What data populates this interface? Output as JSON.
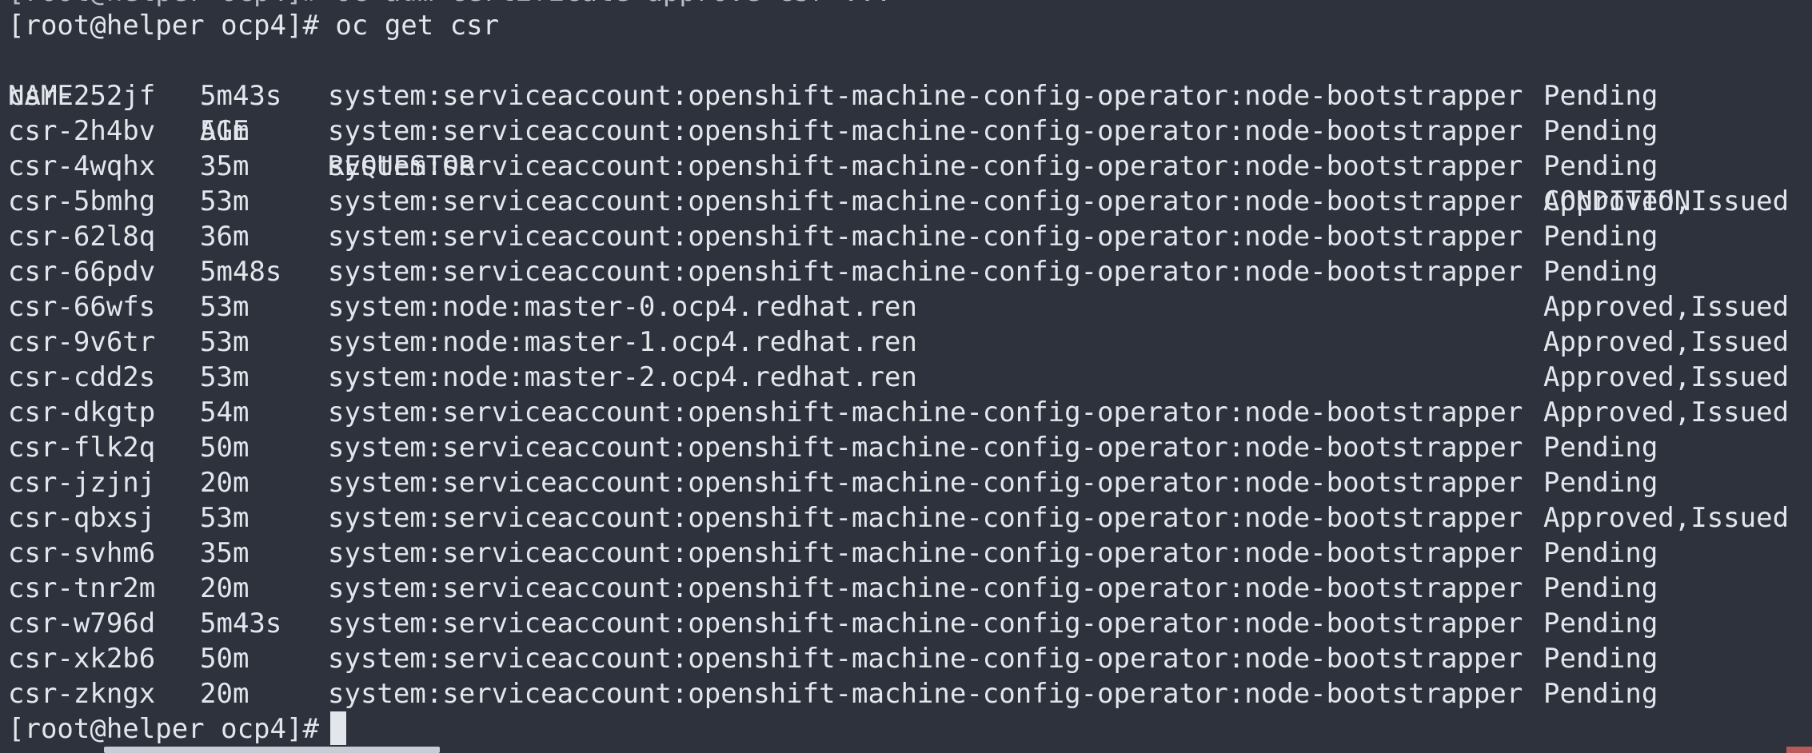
{
  "clipped_line": "[root@helper ocp4]# oc adm certificate approve csr-...",
  "command_line": {
    "prompt": "[root@helper ocp4]#",
    "command": "oc get csr"
  },
  "table": {
    "headers": {
      "name": "NAME",
      "age": "AGE",
      "requestor": "REQUESTOR",
      "condition": "CONDITION"
    },
    "rows": [
      {
        "name": "csr-252jf",
        "age": "5m43s",
        "requestor": "system:serviceaccount:openshift-machine-config-operator:node-bootstrapper",
        "condition": "Pending"
      },
      {
        "name": "csr-2h4bv",
        "age": "51m",
        "requestor": "system:serviceaccount:openshift-machine-config-operator:node-bootstrapper",
        "condition": "Pending"
      },
      {
        "name": "csr-4wqhx",
        "age": "35m",
        "requestor": "system:serviceaccount:openshift-machine-config-operator:node-bootstrapper",
        "condition": "Pending"
      },
      {
        "name": "csr-5bmhg",
        "age": "53m",
        "requestor": "system:serviceaccount:openshift-machine-config-operator:node-bootstrapper",
        "condition": "Approved,Issued"
      },
      {
        "name": "csr-62l8q",
        "age": "36m",
        "requestor": "system:serviceaccount:openshift-machine-config-operator:node-bootstrapper",
        "condition": "Pending"
      },
      {
        "name": "csr-66pdv",
        "age": "5m48s",
        "requestor": "system:serviceaccount:openshift-machine-config-operator:node-bootstrapper",
        "condition": "Pending"
      },
      {
        "name": "csr-66wfs",
        "age": "53m",
        "requestor": "system:node:master-0.ocp4.redhat.ren",
        "condition": "Approved,Issued"
      },
      {
        "name": "csr-9v6tr",
        "age": "53m",
        "requestor": "system:node:master-1.ocp4.redhat.ren",
        "condition": "Approved,Issued"
      },
      {
        "name": "csr-cdd2s",
        "age": "53m",
        "requestor": "system:node:master-2.ocp4.redhat.ren",
        "condition": "Approved,Issued"
      },
      {
        "name": "csr-dkgtp",
        "age": "54m",
        "requestor": "system:serviceaccount:openshift-machine-config-operator:node-bootstrapper",
        "condition": "Approved,Issued"
      },
      {
        "name": "csr-flk2q",
        "age": "50m",
        "requestor": "system:serviceaccount:openshift-machine-config-operator:node-bootstrapper",
        "condition": "Pending"
      },
      {
        "name": "csr-jzjnj",
        "age": "20m",
        "requestor": "system:serviceaccount:openshift-machine-config-operator:node-bootstrapper",
        "condition": "Pending"
      },
      {
        "name": "csr-qbxsj",
        "age": "53m",
        "requestor": "system:serviceaccount:openshift-machine-config-operator:node-bootstrapper",
        "condition": "Approved,Issued"
      },
      {
        "name": "csr-svhm6",
        "age": "35m",
        "requestor": "system:serviceaccount:openshift-machine-config-operator:node-bootstrapper",
        "condition": "Pending"
      },
      {
        "name": "csr-tnr2m",
        "age": "20m",
        "requestor": "system:serviceaccount:openshift-machine-config-operator:node-bootstrapper",
        "condition": "Pending"
      },
      {
        "name": "csr-w796d",
        "age": "5m43s",
        "requestor": "system:serviceaccount:openshift-machine-config-operator:node-bootstrapper",
        "condition": "Pending"
      },
      {
        "name": "csr-xk2b6",
        "age": "50m",
        "requestor": "system:serviceaccount:openshift-machine-config-operator:node-bootstrapper",
        "condition": "Pending"
      },
      {
        "name": "csr-zkngx",
        "age": "20m",
        "requestor": "system:serviceaccount:openshift-machine-config-operator:node-bootstrapper",
        "condition": "Pending"
      }
    ]
  },
  "final_prompt": "[root@helper ocp4]#",
  "colors": {
    "background": "#2e323d",
    "foreground": "#e3e6eb"
  }
}
